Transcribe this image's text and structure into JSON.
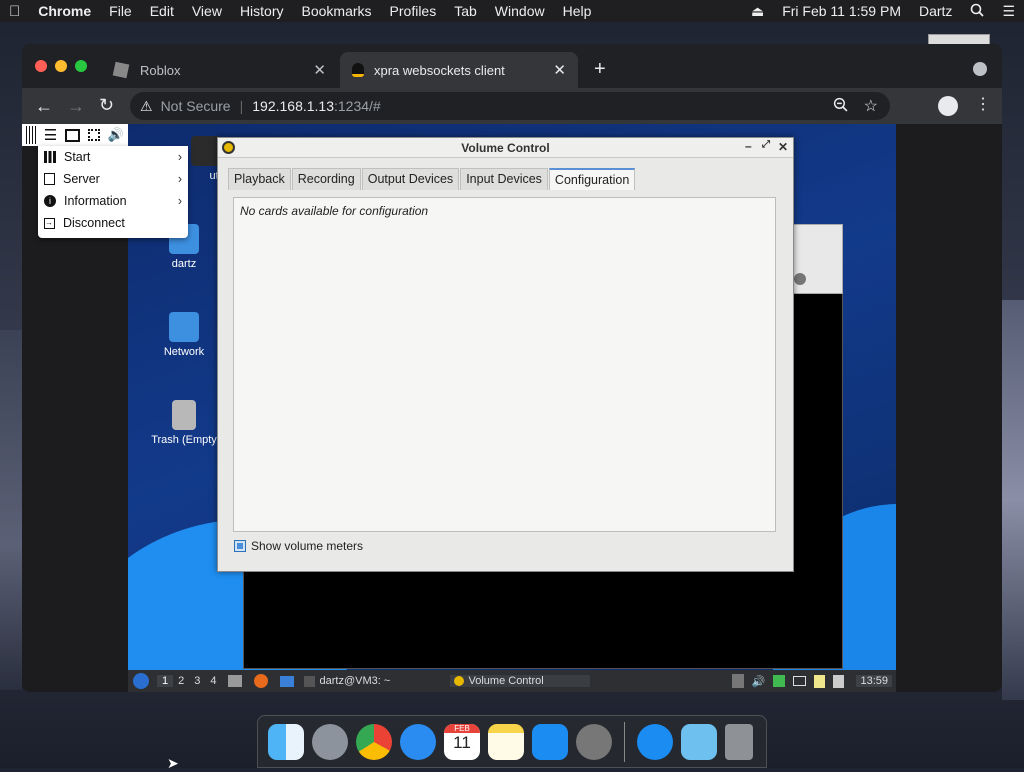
{
  "mac_menubar": {
    "app_name": "Chrome",
    "menus": [
      "File",
      "Edit",
      "View",
      "History",
      "Bookmarks",
      "Profiles",
      "Tab",
      "Window",
      "Help"
    ],
    "clock": "Fri Feb 11  1:59 PM",
    "user": "Dartz"
  },
  "chrome": {
    "tabs": [
      {
        "title": "Roblox"
      },
      {
        "title": "xpra websockets client"
      }
    ],
    "security_label": "Not Secure",
    "url_host": "192.168.1.13",
    "url_rest": ":1234/#"
  },
  "xpra_menu": {
    "items": [
      {
        "label": "Start",
        "icon": "grid-icon"
      },
      {
        "label": "Server",
        "icon": "server-icon"
      },
      {
        "label": "Information",
        "icon": "info-icon"
      },
      {
        "label": "Disconnect",
        "icon": "disconnect-icon"
      }
    ]
  },
  "desktop_icons": [
    {
      "label": "uter"
    },
    {
      "label": "dartz"
    },
    {
      "label": "Network"
    },
    {
      "label": "Trash (Empty"
    }
  ],
  "volume_control": {
    "title": "Volume Control",
    "tabs": [
      "Playback",
      "Recording",
      "Output Devices",
      "Input Devices",
      "Configuration"
    ],
    "active_tab": "Configuration",
    "message": "No cards available for configuration",
    "checkbox_label": "Show volume meters"
  },
  "panel": {
    "workspaces": [
      "1",
      "2",
      "3",
      "4"
    ],
    "task_terminal": "dartz@VM3: ~",
    "task_volume": "Volume Control",
    "clock": "13:59"
  },
  "dock": {
    "calendar_month": "FEB",
    "calendar_day": "11"
  }
}
